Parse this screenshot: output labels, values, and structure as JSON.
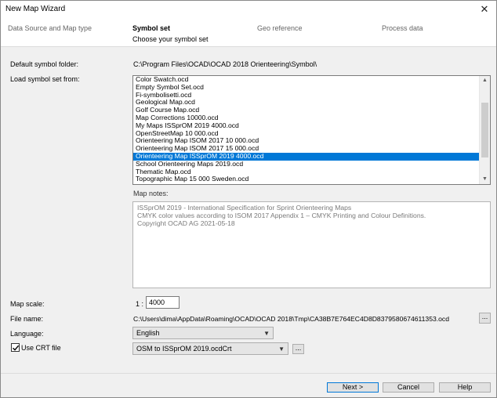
{
  "window": {
    "title": "New Map Wizard",
    "close_glyph": "✕"
  },
  "steps": [
    {
      "label": "Data Source and Map type"
    },
    {
      "label": "Symbol set",
      "sub": "Choose your symbol set"
    },
    {
      "label": "Geo reference"
    },
    {
      "label": "Process data"
    }
  ],
  "default_folder": {
    "label": "Default symbol folder:",
    "value": "C:\\Program Files\\OCAD\\OCAD 2018 Orienteering\\Symbol\\"
  },
  "load_from": {
    "label": "Load symbol set from:",
    "items": [
      "Color Swatch.ocd",
      "Empty Symbol Set.ocd",
      "Fi-symbolisetti.ocd",
      "Geological Map.ocd",
      "Golf Course Map.ocd",
      "Map Corrections 10000.ocd",
      "My Maps ISSprOM 2019 4000.ocd",
      "OpenStreetMap 10 000.ocd",
      "Orienteering Map ISOM 2017 10 000.ocd",
      "Orienteering Map ISOM 2017 15 000.ocd",
      "Orienteering Map ISSprOM 2019 4000.ocd",
      "School Orienteering Maps 2019.ocd",
      "Thematic Map.ocd",
      "Topographic Map 15 000 Sweden.ocd"
    ],
    "selected_index": 10
  },
  "map_notes": {
    "label": "Map notes:",
    "lines": [
      "ISSprOM 2019 - International Specification for Sprint Orienteering Maps",
      "CMYK color values according to ISOM 2017 Appendix 1 – CMYK Printing and Colour Definitions.",
      "Copyright OCAD AG 2021-05-18"
    ]
  },
  "map_scale": {
    "label": "Map scale:",
    "prefix": "1 :",
    "value": "4000"
  },
  "file_name": {
    "label": "File name:",
    "value": "C:\\Users\\dima\\AppData\\Roaming\\OCAD\\OCAD 2018\\Tmp\\CA38B7E764EC4D8D8379580674611353.ocd",
    "browse": "..."
  },
  "language": {
    "label": "Language:",
    "value": "English"
  },
  "crt": {
    "label": "Use CRT file",
    "checked": true,
    "value": "OSM to ISSprOM 2019.ocdCrt",
    "browse": "..."
  },
  "buttons": {
    "next": "Next >",
    "cancel": "Cancel",
    "help": "Help"
  },
  "colors": {
    "selection": "#0078d7",
    "background": "#f0f0f0"
  }
}
